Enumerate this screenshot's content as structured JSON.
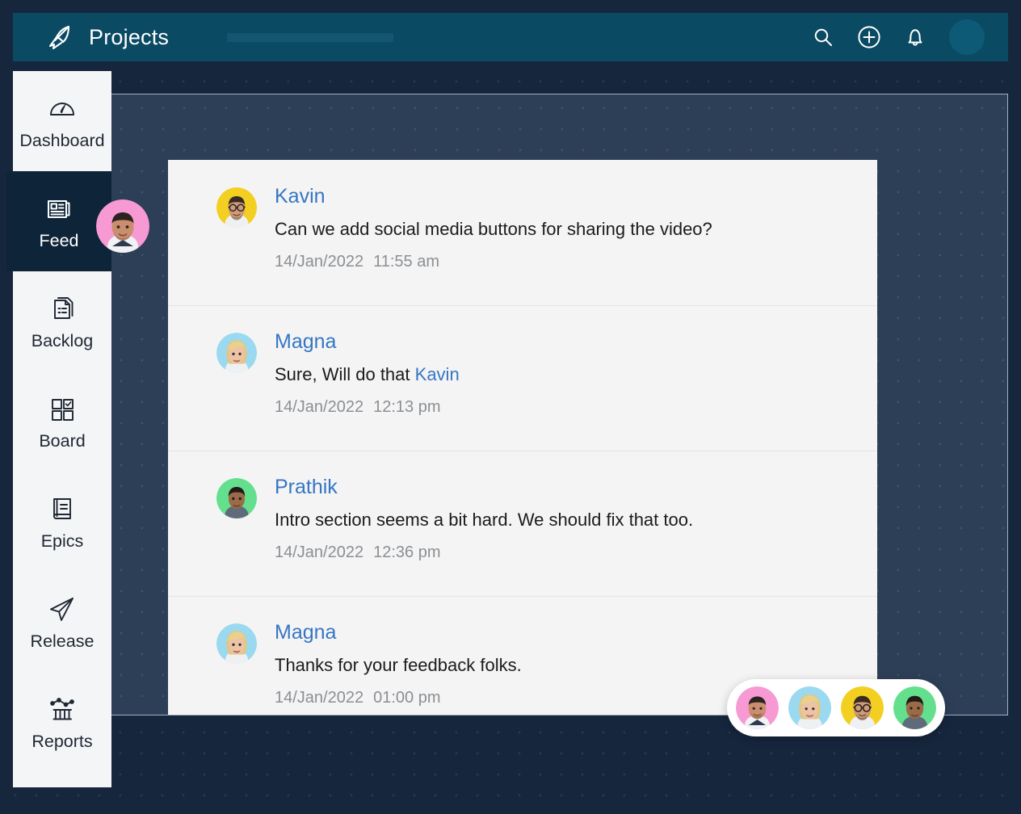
{
  "header": {
    "logo_icon": "rocket-icon",
    "title": "Projects",
    "search_icon": "search-icon",
    "add_icon": "plus-circle-icon",
    "notification_icon": "bell-icon",
    "avatar": "user-avatar"
  },
  "sidebar": {
    "items": [
      {
        "label": "Dashboard",
        "icon": "speedometer-icon",
        "active": false
      },
      {
        "label": "Feed",
        "icon": "news-article-icon",
        "active": true
      },
      {
        "label": "Backlog",
        "icon": "documents-icon",
        "active": false
      },
      {
        "label": "Board",
        "icon": "grid-check-icon",
        "active": false
      },
      {
        "label": "Epics",
        "icon": "book-icon",
        "active": false
      },
      {
        "label": "Release",
        "icon": "paper-plane-icon",
        "active": false
      },
      {
        "label": "Reports",
        "icon": "bar-chart-icon",
        "active": false
      }
    ]
  },
  "feed": {
    "posts": [
      {
        "author": "Kavin",
        "text": "Can we add social media buttons for sharing the video?",
        "date": "14/Jan/2022",
        "time": "11:55 am",
        "avatar_color": "#f2cf21"
      },
      {
        "author": "Magna",
        "text_before": "Sure, Will do that ",
        "mention": "Kavin",
        "text_after": "",
        "date": "14/Jan/2022",
        "time": "12:13 pm",
        "avatar_color": "#9ad9f0"
      },
      {
        "author": "Prathik",
        "text": "Intro section seems a bit hard. We should fix that too.",
        "date": "14/Jan/2022",
        "time": "12:36 pm",
        "avatar_color": "#63df8d"
      },
      {
        "author": "Magna",
        "text": "Thanks for your feedback folks.",
        "date": "14/Jan/2022",
        "time": "01:00 pm",
        "avatar_color": "#9ad9f0"
      }
    ]
  },
  "member_pill": {
    "members": [
      {
        "name": "member-1",
        "avatar_color": "#f79ad3"
      },
      {
        "name": "member-2",
        "avatar_color": "#9ad9f0"
      },
      {
        "name": "member-3",
        "avatar_color": "#f2cf21"
      },
      {
        "name": "member-4",
        "avatar_color": "#63df8d"
      }
    ]
  },
  "colors": {
    "header_bg": "#0b4a63",
    "page_bg": "#16263d",
    "panel_bg": "#2d3f57",
    "sidebar_bg": "#f4f5f7",
    "active_nav_bg": "#0e2438",
    "card_bg": "#f4f4f4",
    "link": "#3576c4",
    "meta_text": "#8b8f94"
  }
}
